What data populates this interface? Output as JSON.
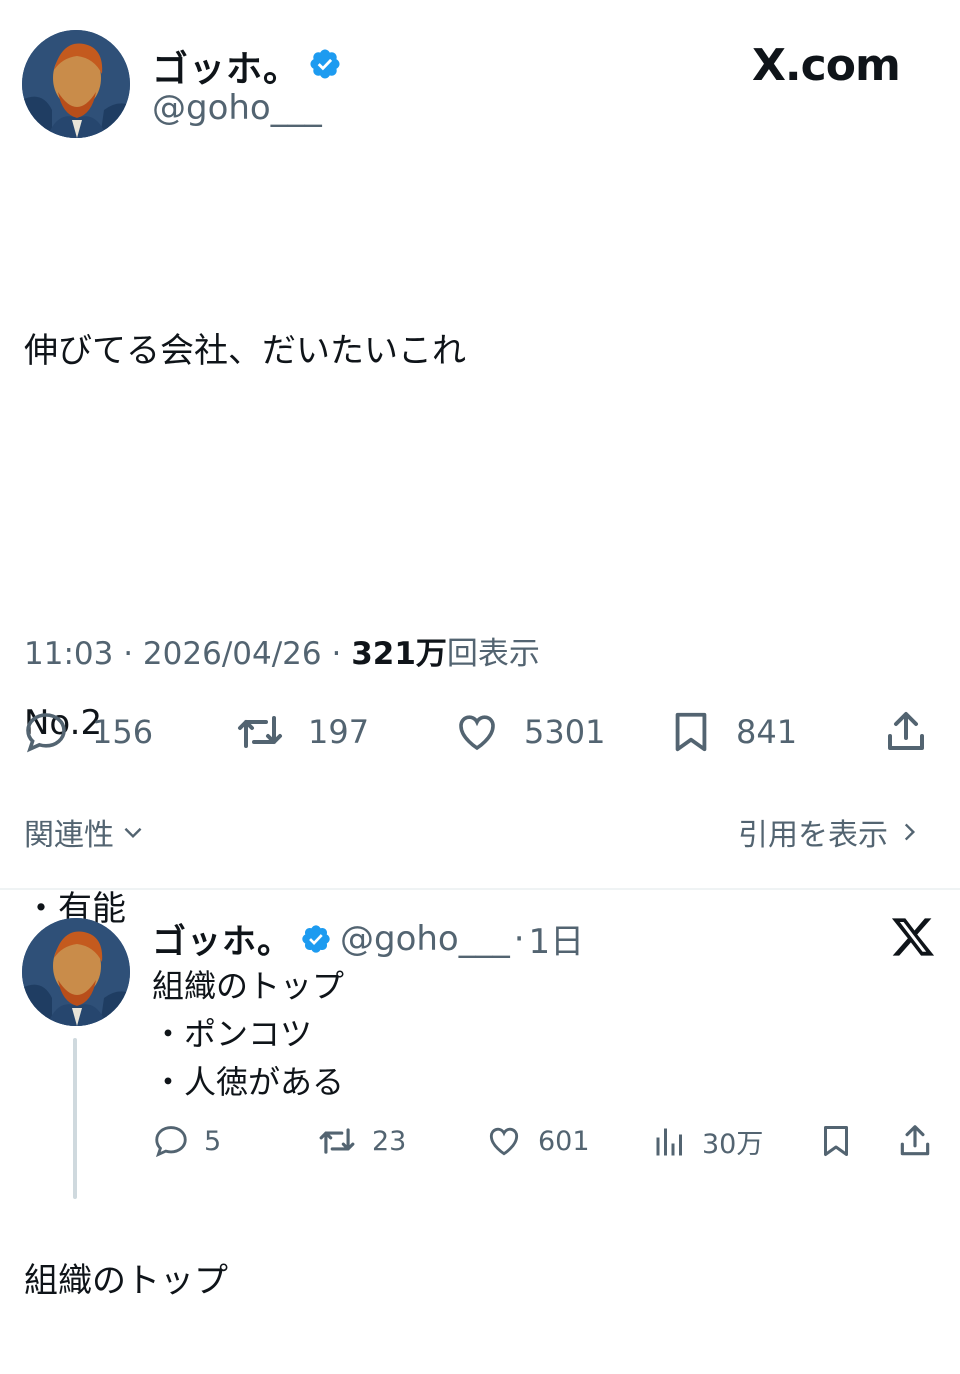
{
  "brand": {
    "logo_text": "X.com"
  },
  "tweet": {
    "author_name": "ゴッホ。",
    "handle": "@goho___",
    "text_lines": [
      "伸びてる会社、だいたいこれ",
      "",
      "No.2",
      "・有能",
      "",
      "組織のトップ"
    ],
    "time": "11:03",
    "date": "2026/04/26",
    "views_value": "321万",
    "views_suffix": "回表示",
    "separator": "·",
    "stats": {
      "replies": "156",
      "reposts": "197",
      "likes": "5301",
      "bookmarks": "841"
    }
  },
  "links": {
    "relevance": "関連性",
    "view_quotes": "引用を表示"
  },
  "reply": {
    "author_name": "ゴッホ。",
    "handle": "@goho___",
    "age": "1日",
    "separator": "·",
    "text_lines": [
      "組織のトップ",
      "・ポンコツ",
      "・人徳がある"
    ],
    "stats": {
      "replies": "5",
      "reposts": "23",
      "likes": "601",
      "views": "30万"
    }
  },
  "colors": {
    "verified": "#1d9bf0",
    "muted": "#536471",
    "text": "#0f1419"
  },
  "icons": [
    "verified-badge-icon",
    "reply-icon",
    "repost-icon",
    "like-icon",
    "bookmark-icon",
    "share-icon",
    "views-icon",
    "x-logo-icon",
    "chevron-down-icon",
    "chevron-right-icon"
  ]
}
